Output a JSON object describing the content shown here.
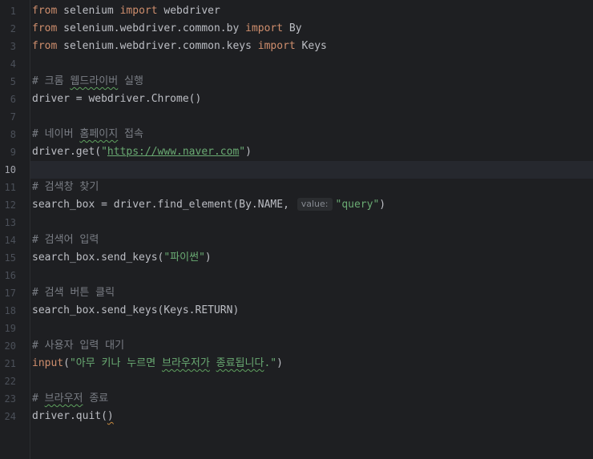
{
  "editor": {
    "current_line": 10,
    "lines": [
      {
        "n": "1",
        "tokens": [
          {
            "t": "from",
            "c": "kw"
          },
          {
            "t": " selenium "
          },
          {
            "t": "import",
            "c": "kw"
          },
          {
            "t": " webdriver"
          }
        ]
      },
      {
        "n": "2",
        "tokens": [
          {
            "t": "from",
            "c": "kw"
          },
          {
            "t": " selenium.webdriver.common.by "
          },
          {
            "t": "import",
            "c": "kw"
          },
          {
            "t": " By"
          }
        ]
      },
      {
        "n": "3",
        "tokens": [
          {
            "t": "from",
            "c": "kw"
          },
          {
            "t": " selenium.webdriver.common.keys "
          },
          {
            "t": "import",
            "c": "kw"
          },
          {
            "t": " Keys"
          }
        ]
      },
      {
        "n": "4",
        "tokens": []
      },
      {
        "n": "5",
        "tokens": [
          {
            "t": "# 크롬 ",
            "c": "cm"
          },
          {
            "t": "웹드라이버",
            "c": "cm squig"
          },
          {
            "t": " 실행",
            "c": "cm"
          }
        ]
      },
      {
        "n": "6",
        "tokens": [
          {
            "t": "driver = webdriver.Chrome()"
          }
        ]
      },
      {
        "n": "7",
        "tokens": []
      },
      {
        "n": "8",
        "tokens": [
          {
            "t": "# 네이버 ",
            "c": "cm"
          },
          {
            "t": "홈페이지",
            "c": "cm squig"
          },
          {
            "t": " 접속",
            "c": "cm"
          }
        ]
      },
      {
        "n": "9",
        "tokens": [
          {
            "t": "driver.get("
          },
          {
            "t": "\"",
            "c": "str"
          },
          {
            "t": "https://www.naver.com",
            "c": "str url"
          },
          {
            "t": "\"",
            "c": "str"
          },
          {
            "t": ")"
          }
        ]
      },
      {
        "n": "10",
        "tokens": []
      },
      {
        "n": "11",
        "tokens": [
          {
            "t": "# 검색창 찾기",
            "c": "cm"
          }
        ]
      },
      {
        "n": "12",
        "tokens": [
          {
            "t": "search_box = driver.find_element(By.NAME, "
          },
          {
            "t": "value:",
            "c": "hint"
          },
          {
            "t": "\"query\"",
            "c": "str"
          },
          {
            "t": ")"
          }
        ]
      },
      {
        "n": "13",
        "tokens": []
      },
      {
        "n": "14",
        "tokens": [
          {
            "t": "# 검색어 입력",
            "c": "cm"
          }
        ]
      },
      {
        "n": "15",
        "tokens": [
          {
            "t": "search_box.send_keys("
          },
          {
            "t": "\"파이썬\"",
            "c": "str"
          },
          {
            "t": ")"
          }
        ]
      },
      {
        "n": "16",
        "tokens": []
      },
      {
        "n": "17",
        "tokens": [
          {
            "t": "# 검색 버튼 클릭",
            "c": "cm"
          }
        ]
      },
      {
        "n": "18",
        "tokens": [
          {
            "t": "search_box.send_keys(Keys.RETURN)"
          }
        ]
      },
      {
        "n": "19",
        "tokens": []
      },
      {
        "n": "20",
        "tokens": [
          {
            "t": "# 사용자 입력 대기",
            "c": "cm"
          }
        ]
      },
      {
        "n": "21",
        "tokens": [
          {
            "t": "input",
            "c": "kw"
          },
          {
            "t": "("
          },
          {
            "t": "\"아무 키나 누르면 ",
            "c": "str"
          },
          {
            "t": "브라우저가",
            "c": "str squig"
          },
          {
            "t": " ",
            "c": "str"
          },
          {
            "t": "종료됩니다",
            "c": "str squig"
          },
          {
            "t": ".\"",
            "c": "str"
          },
          {
            "t": ")"
          }
        ]
      },
      {
        "n": "22",
        "tokens": []
      },
      {
        "n": "23",
        "tokens": [
          {
            "t": "# ",
            "c": "cm"
          },
          {
            "t": "브라우저",
            "c": "cm squig"
          },
          {
            "t": " 종료",
            "c": "cm"
          }
        ]
      },
      {
        "n": "24",
        "tokens": [
          {
            "t": "driver.quit("
          },
          {
            "t": ")",
            "c": "squig-warn"
          }
        ]
      }
    ]
  }
}
